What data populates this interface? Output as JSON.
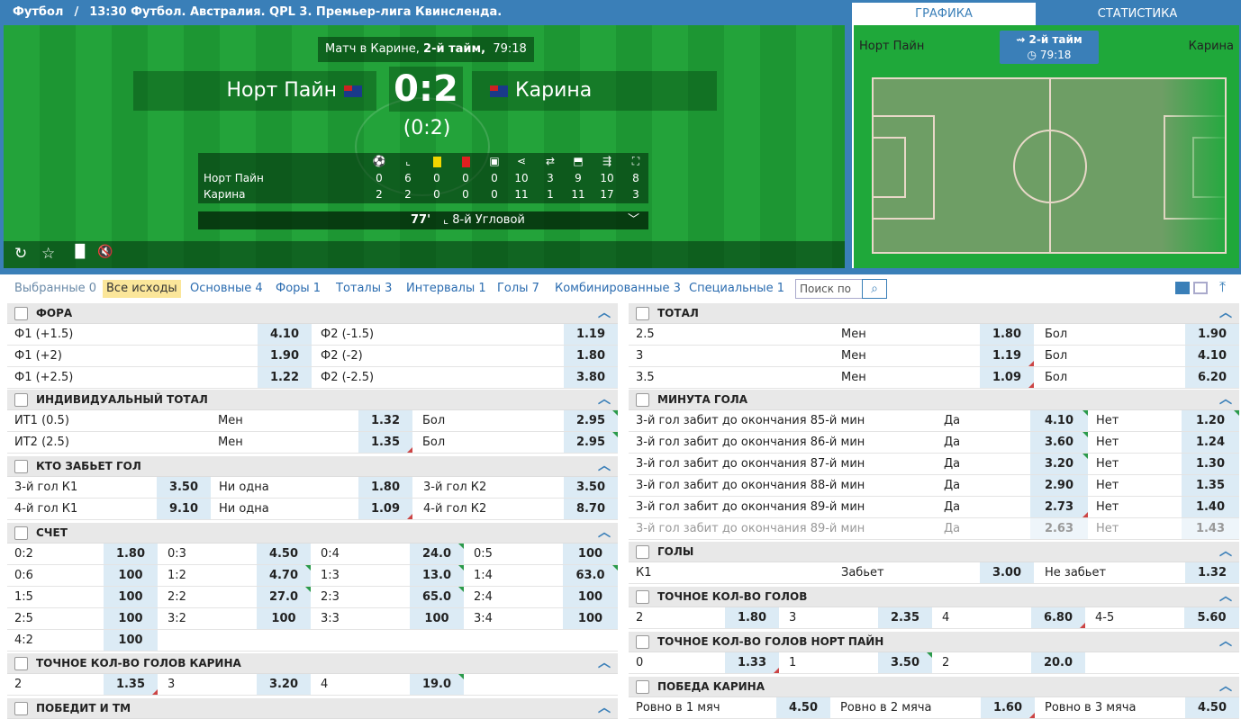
{
  "breadcrumb": {
    "sport": "Футбол",
    "match": "13:30 Футбол. Австралия. QPL 3. Премьер-лига Квинсленда."
  },
  "match": {
    "status_prefix": "Матч в Карине,",
    "period": "2-й тайм,",
    "clock": "79:18",
    "home": "Норт Пайн",
    "away": "Карина",
    "score": "0:2",
    "half_score": "(0:2)"
  },
  "stats": {
    "home": [
      "0",
      "6",
      "0",
      "0",
      "0",
      "10",
      "3",
      "9",
      "10",
      "8"
    ],
    "away": [
      "2",
      "2",
      "0",
      "0",
      "0",
      "11",
      "1",
      "11",
      "17",
      "3"
    ]
  },
  "event": {
    "minute": "77'",
    "text": "8-й Угловой"
  },
  "right_panel": {
    "tab1": "ГРАФИКА",
    "tab2": "СТАТИСТИКА",
    "home": "Норт Пайн",
    "away": "Карина",
    "period": "2-й тайм",
    "clock": "79:18"
  },
  "tabs": [
    "Выбранные 0",
    "Все исходы",
    "Основные 4",
    "Форы 1",
    "Тоталы 3",
    "Интервалы 1",
    "Голы 7",
    "Комбинированные 3",
    "Специальные 1"
  ],
  "search_placeholder": "Поиск по",
  "fora": {
    "title": "ФОРА",
    "rows": [
      [
        "Ф1 (+1.5)",
        "4.10",
        "Ф2 (-1.5)",
        "1.19"
      ],
      [
        "Ф1 (+2)",
        "1.90",
        "Ф2 (-2)",
        "1.80"
      ],
      [
        "Ф1 (+2.5)",
        "1.22",
        "Ф2 (-2.5)",
        "3.80"
      ]
    ]
  },
  "ind_total": {
    "title": "ИНДИВИДУАЛЬНЫЙ ТОТАЛ",
    "rows": [
      [
        "ИТ1 (0.5)",
        "Мен",
        "1.32",
        "Бол",
        "2.95"
      ],
      [
        "ИТ2 (2.5)",
        "Мен",
        "1.35",
        "Бол",
        "2.95"
      ]
    ]
  },
  "who_scores": {
    "title": "КТО ЗАБЬЕТ ГОЛ",
    "rows": [
      [
        "3-й гол К1",
        "3.50",
        "Ни одна",
        "1.80",
        "3-й гол К2",
        "3.50"
      ],
      [
        "4-й гол К1",
        "9.10",
        "Ни одна",
        "1.09",
        "4-й гол К2",
        "8.70"
      ]
    ]
  },
  "score_sec": {
    "title": "СЧЕТ",
    "rows": [
      [
        "0:2",
        "1.80",
        "0:3",
        "4.50",
        "0:4",
        "24.0",
        "0:5",
        "100"
      ],
      [
        "0:6",
        "100",
        "1:2",
        "4.70",
        "1:3",
        "13.0",
        "1:4",
        "63.0"
      ],
      [
        "1:5",
        "100",
        "2:2",
        "27.0",
        "2:3",
        "65.0",
        "2:4",
        "100"
      ],
      [
        "2:5",
        "100",
        "3:2",
        "100",
        "3:3",
        "100",
        "3:4",
        "100"
      ],
      [
        "4:2",
        "100"
      ]
    ]
  },
  "exact_karina": {
    "title": "ТОЧНОЕ КОЛ-ВО ГОЛОВ КАРИНА",
    "row": [
      "2",
      "1.35",
      "3",
      "3.20",
      "4",
      "19.0"
    ]
  },
  "win_tm": {
    "title": "ПОБЕДИТ И ТМ"
  },
  "total": {
    "title": "ТОТАЛ",
    "rows": [
      [
        "2.5",
        "Мен",
        "1.80",
        "Бол",
        "1.90"
      ],
      [
        "3",
        "Мен",
        "1.19",
        "Бол",
        "4.10"
      ],
      [
        "3.5",
        "Мен",
        "1.09",
        "Бол",
        "6.20"
      ]
    ]
  },
  "goal_minute": {
    "title": "МИНУТА ГОЛА",
    "rows": [
      [
        "3-й гол забит до окончания 85-й мин",
        "Да",
        "4.10",
        "Нет",
        "1.20"
      ],
      [
        "3-й гол забит до окончания 86-й мин",
        "Да",
        "3.60",
        "Нет",
        "1.24"
      ],
      [
        "3-й гол забит до окончания 87-й мин",
        "Да",
        "3.20",
        "Нет",
        "1.30"
      ],
      [
        "3-й гол забит до окончания 88-й мин",
        "Да",
        "2.90",
        "Нет",
        "1.35"
      ],
      [
        "3-й гол забит до окончания 89-й мин",
        "Да",
        "2.73",
        "Нет",
        "1.40"
      ],
      [
        "3-й гол забит до окончания 89-й мин",
        "Да",
        "2.63",
        "Нет",
        "1.43"
      ]
    ]
  },
  "goals": {
    "title": "ГОЛЫ",
    "row": [
      "К1",
      "Забьет",
      "3.00",
      "Не забьет",
      "1.32"
    ]
  },
  "exact_goals": {
    "title": "ТОЧНОЕ КОЛ-ВО ГОЛОВ",
    "row": [
      "2",
      "1.80",
      "3",
      "2.35",
      "4",
      "6.80",
      "4-5",
      "5.60"
    ]
  },
  "exact_nortpain": {
    "title": "ТОЧНОЕ КОЛ-ВО ГОЛОВ НОРТ ПАЙН",
    "row": [
      "0",
      "1.33",
      "1",
      "3.50",
      "2",
      "20.0"
    ]
  },
  "win_karina": {
    "title": "ПОБЕДА КАРИНА",
    "row": [
      "Ровно в 1 мяч",
      "4.50",
      "Ровно в 2 мяча",
      "1.60",
      "Ровно в 3 мяча",
      "4.50"
    ]
  }
}
